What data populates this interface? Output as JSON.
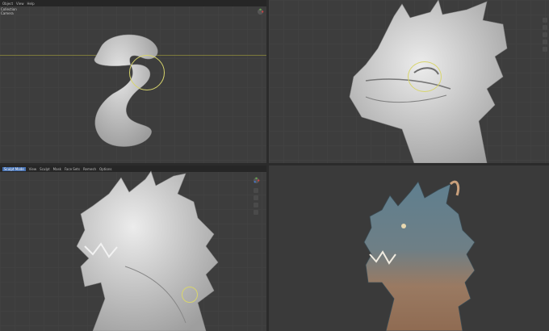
{
  "panes": {
    "top_left": {
      "header": [
        "Object",
        "View",
        "Help"
      ],
      "outliner": [
        "Collection",
        "Camera"
      ]
    },
    "bottom_left": {
      "header": [
        "Sculpt Mode",
        "View",
        "Sculpt",
        "Mask",
        "Face Sets",
        "Remesh",
        "Options"
      ]
    }
  },
  "colors": {
    "viewport_bg": "#3d3d3d",
    "clay": "#cfcfcf",
    "brush_ring": "#d8d56c",
    "accent": "#4772b3"
  },
  "icons": [
    "axis-gizmo-icon",
    "grab-hand-icon",
    "zoom-icon",
    "camera-icon",
    "grid-icon"
  ]
}
